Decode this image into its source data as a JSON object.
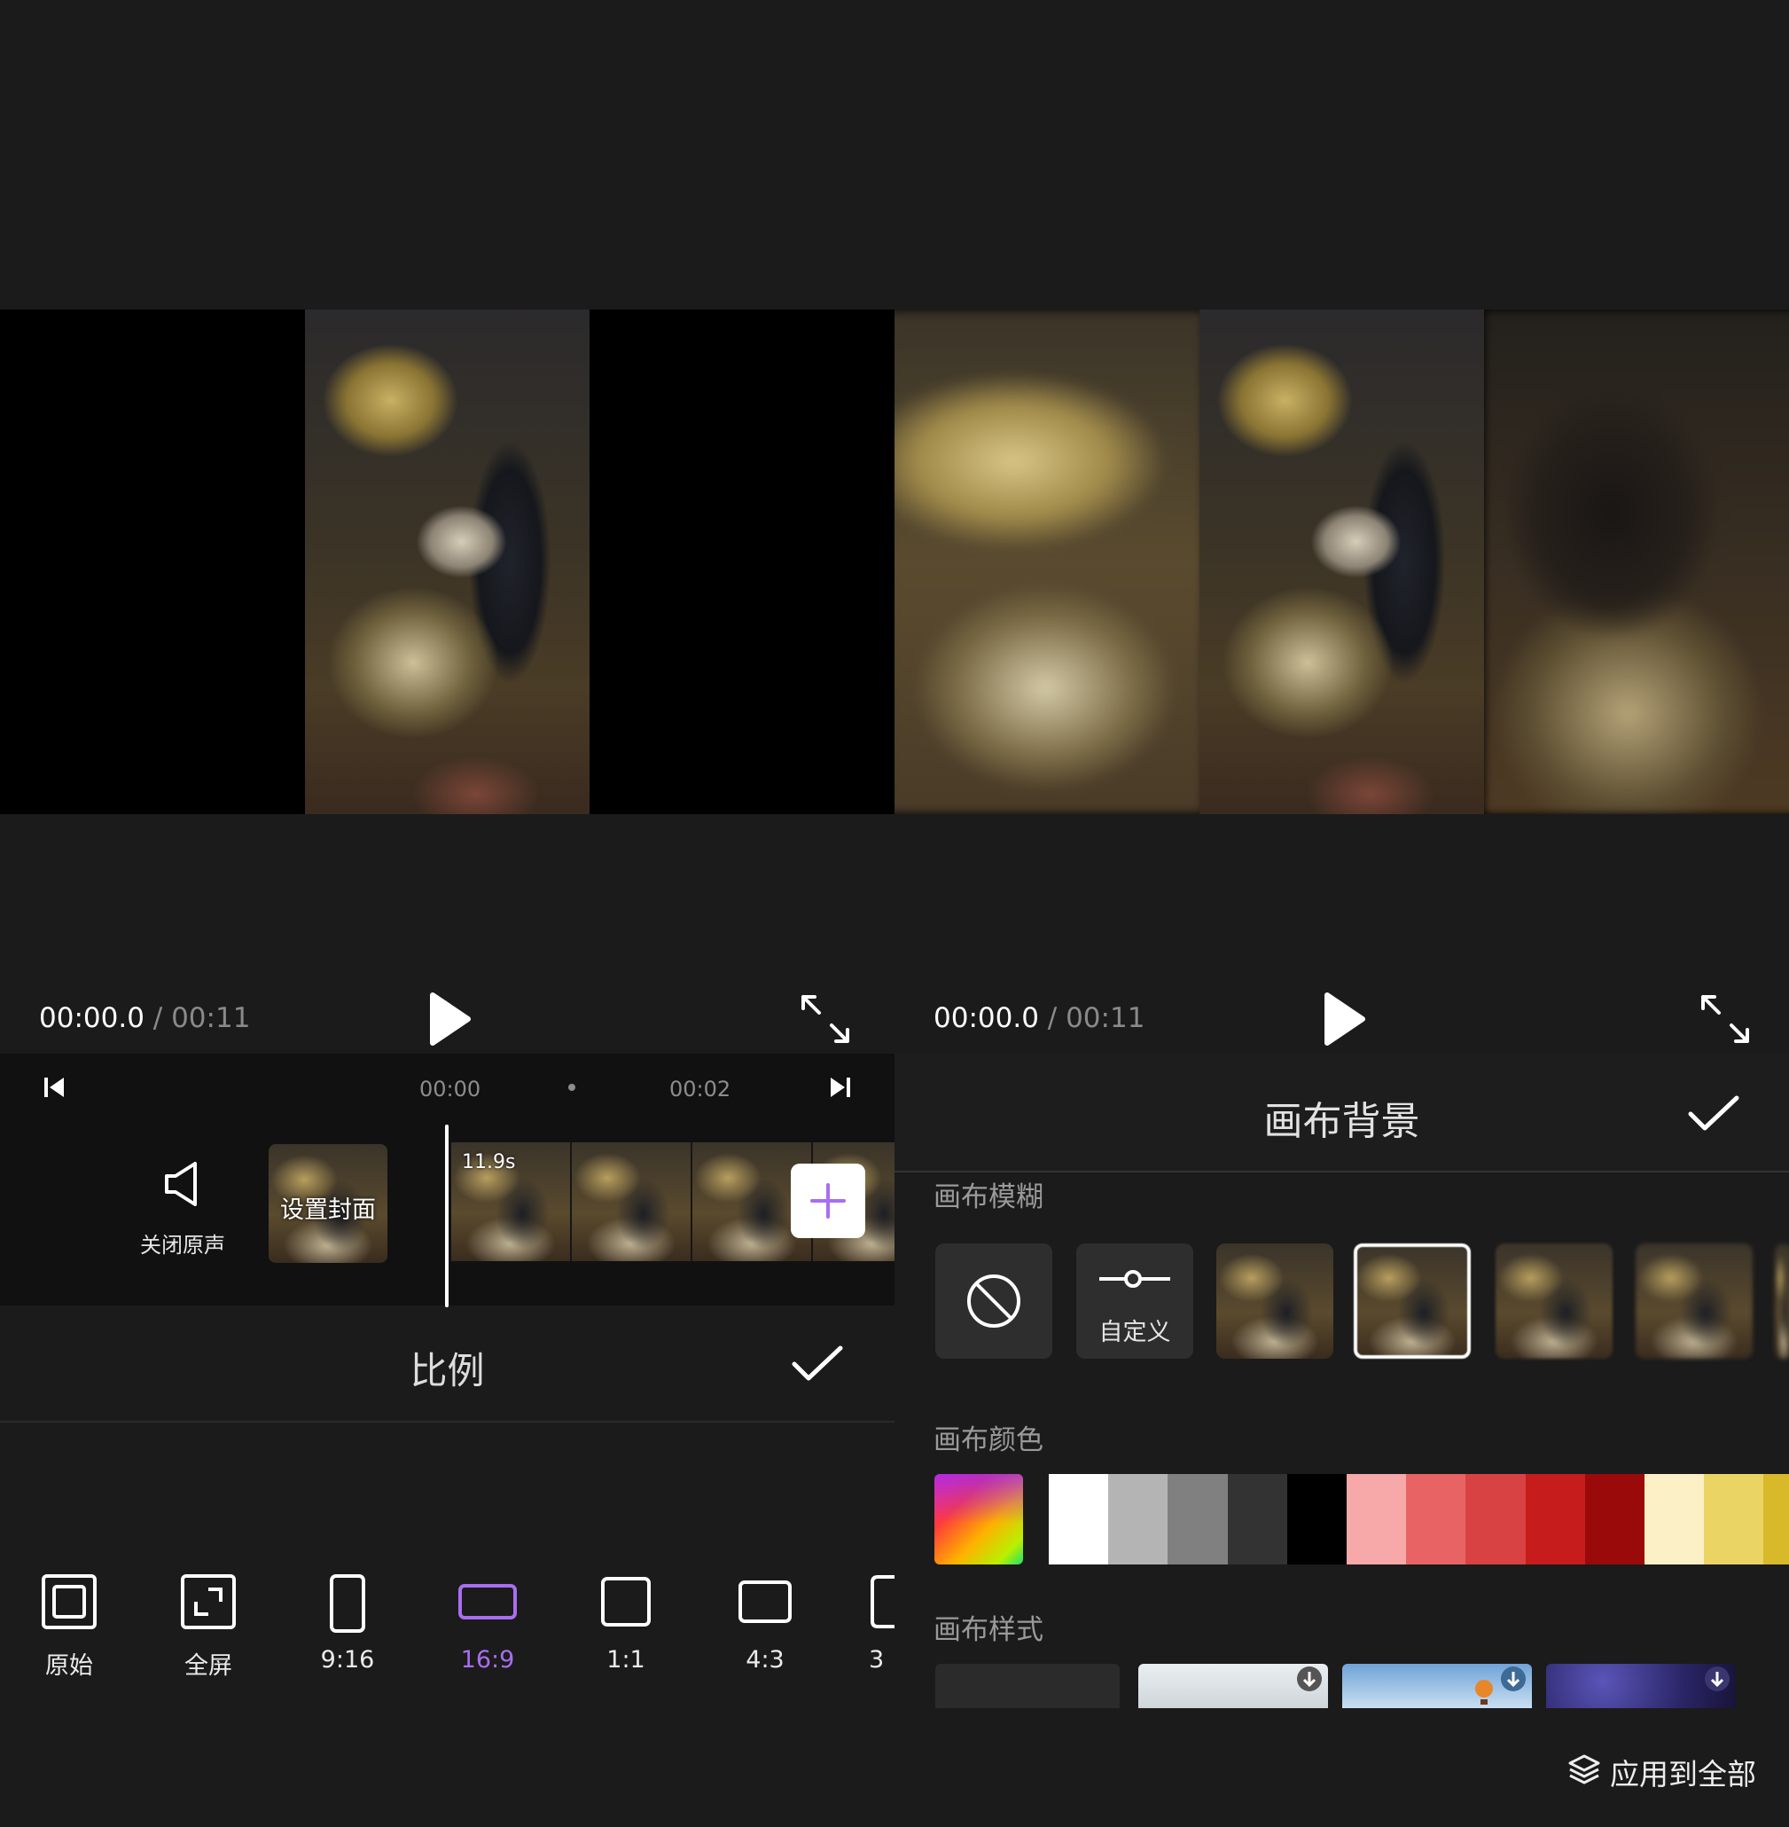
{
  "left": {
    "time_current": "00:00.0",
    "time_sep": " / ",
    "time_total": "00:11",
    "ruler": [
      "00:00",
      "00:02"
    ],
    "mute_label": "关闭原声",
    "cover_label": "设置封面",
    "clip_duration": "11.9s",
    "sheet_title": "比例",
    "ratios": [
      {
        "label": "原始",
        "icon": "original-icon"
      },
      {
        "label": "全屏",
        "icon": "fullscreen-icon"
      },
      {
        "label": "9:16",
        "icon": "ratio-9-16-icon"
      },
      {
        "label": "16:9",
        "icon": "ratio-16-9-icon",
        "selected": true
      },
      {
        "label": "1:1",
        "icon": "ratio-1-1-icon"
      },
      {
        "label": "4:3",
        "icon": "ratio-4-3-icon"
      },
      {
        "label": "3",
        "icon": "ratio-3-icon"
      }
    ]
  },
  "right": {
    "time_current": "00:00.0",
    "time_sep": " / ",
    "time_total": "00:11",
    "sheet_title": "画布背景",
    "blur_section": "画布模糊",
    "custom_label": "自定义",
    "selected_blur_index": 1,
    "color_section": "画布颜色",
    "colors": [
      "#ffffff",
      "#b4b4b4",
      "#808080",
      "#333333",
      "#000000",
      "#f7a8a8",
      "#e86464",
      "#d94242",
      "#c71c1c",
      "#9b0a0a",
      "#fbf0c6",
      "#e9d464",
      "#d8b92a"
    ],
    "style_section": "画布样式",
    "apply_all": "应用到全部"
  },
  "colors": {
    "background": "#1b1b1b",
    "timeline": "#111111",
    "accent": "#a96ef0"
  }
}
